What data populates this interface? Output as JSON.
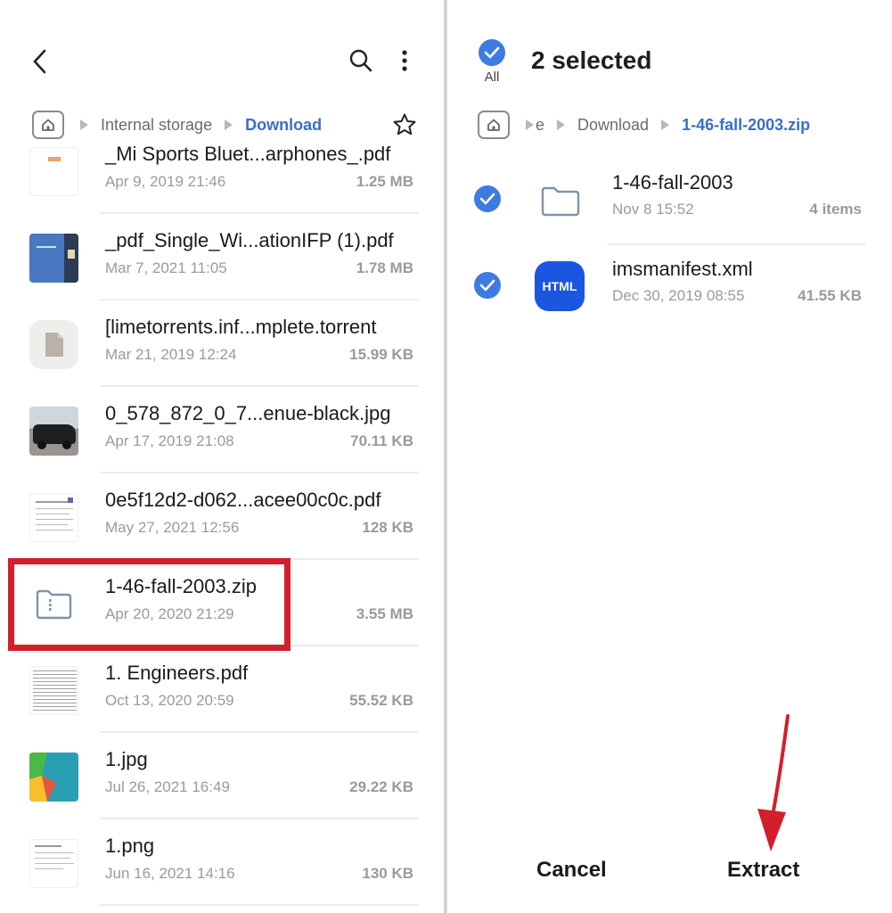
{
  "left": {
    "breadcrumb": [
      "Internal storage",
      "Download"
    ],
    "files": [
      {
        "name": "_Mi Sports Bluet...arphones_.pdf",
        "date": "Apr 9, 2019 21:46",
        "size": "1.25 MB",
        "thumb": "pdf-thumb"
      },
      {
        "name": "_pdf_Single_Wi...ationIFP (1).pdf",
        "date": "Mar 7, 2021 11:05",
        "size": "1.78 MB",
        "thumb": "pdf-cover-thumb"
      },
      {
        "name": "[limetorrents.inf...mplete.torrent",
        "date": "Mar 21, 2019 12:24",
        "size": "15.99 KB",
        "thumb": "generic-file-icon"
      },
      {
        "name": "0_578_872_0_7...enue-black.jpg",
        "date": "Apr 17, 2019 21:08",
        "size": "70.11 KB",
        "thumb": "car-photo-thumb"
      },
      {
        "name": "0e5f12d2-d062...acee00c0c.pdf",
        "date": "May 27, 2021 12:56",
        "size": "128 KB",
        "thumb": "document-thumb"
      },
      {
        "name": "1-46-fall-2003.zip",
        "date": "Apr 20, 2020 21:29",
        "size": "3.55 MB",
        "thumb": "zip-icon"
      },
      {
        "name": "1. Engineers.pdf",
        "date": "Oct 13, 2020 20:59",
        "size": "55.52 KB",
        "thumb": "table-doc-thumb"
      },
      {
        "name": "1.jpg",
        "date": "Jul 26, 2021 16:49",
        "size": "29.22 KB",
        "thumb": "colorful-image-thumb"
      },
      {
        "name": "1.png",
        "date": "Jun 16, 2021 14:16",
        "size": "130 KB",
        "thumb": "text-image-thumb"
      }
    ]
  },
  "right": {
    "select_all_label": "All",
    "selected_title": "2 selected",
    "breadcrumb": [
      "e",
      "Download",
      "1-46-fall-2003.zip"
    ],
    "items": [
      {
        "name": "1-46-fall-2003",
        "date": "Nov 8 15:52",
        "size": "4 items",
        "icon": "folder-icon"
      },
      {
        "name": "imsmanifest.xml",
        "date": "Dec 30, 2019 08:55",
        "size": "41.55 KB",
        "icon": "html-file-icon",
        "badge": "HTML"
      }
    ],
    "cancel_label": "Cancel",
    "extract_label": "Extract"
  },
  "colors": {
    "accent": "#3d7be0",
    "highlight": "#d21f2b",
    "arrow": "#d21f2b"
  }
}
